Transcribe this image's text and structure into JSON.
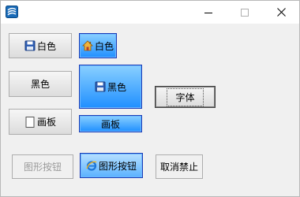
{
  "window": {
    "title": "",
    "controls": {
      "minimize": "—",
      "maximize": "☐",
      "close": "✕"
    }
  },
  "buttons": {
    "white_std": {
      "label": "白色",
      "icon": "floppy-disk-icon"
    },
    "white_blue": {
      "label": "白色",
      "icon": "house-icon"
    },
    "black_std": {
      "label": "黑色"
    },
    "black_blue_big": {
      "label": "黑色",
      "icon": "floppy-disk-icon"
    },
    "font": {
      "label": "字体"
    },
    "canvas_std": {
      "label": "画板",
      "icon": "blank-page-icon"
    },
    "canvas_blue": {
      "label": "画板"
    },
    "graphic_disabled": {
      "label": "图形按钮"
    },
    "graphic_blue": {
      "label": "图形按钮",
      "icon": "ie-logo-icon"
    },
    "cancel_disable": {
      "label": "取消禁止"
    }
  },
  "colors": {
    "accent_blue": "#1f8fff",
    "accent_light": "#8ad0ff",
    "border_blue": "#1b3cb5",
    "client_bg": "#f0f0f0"
  }
}
